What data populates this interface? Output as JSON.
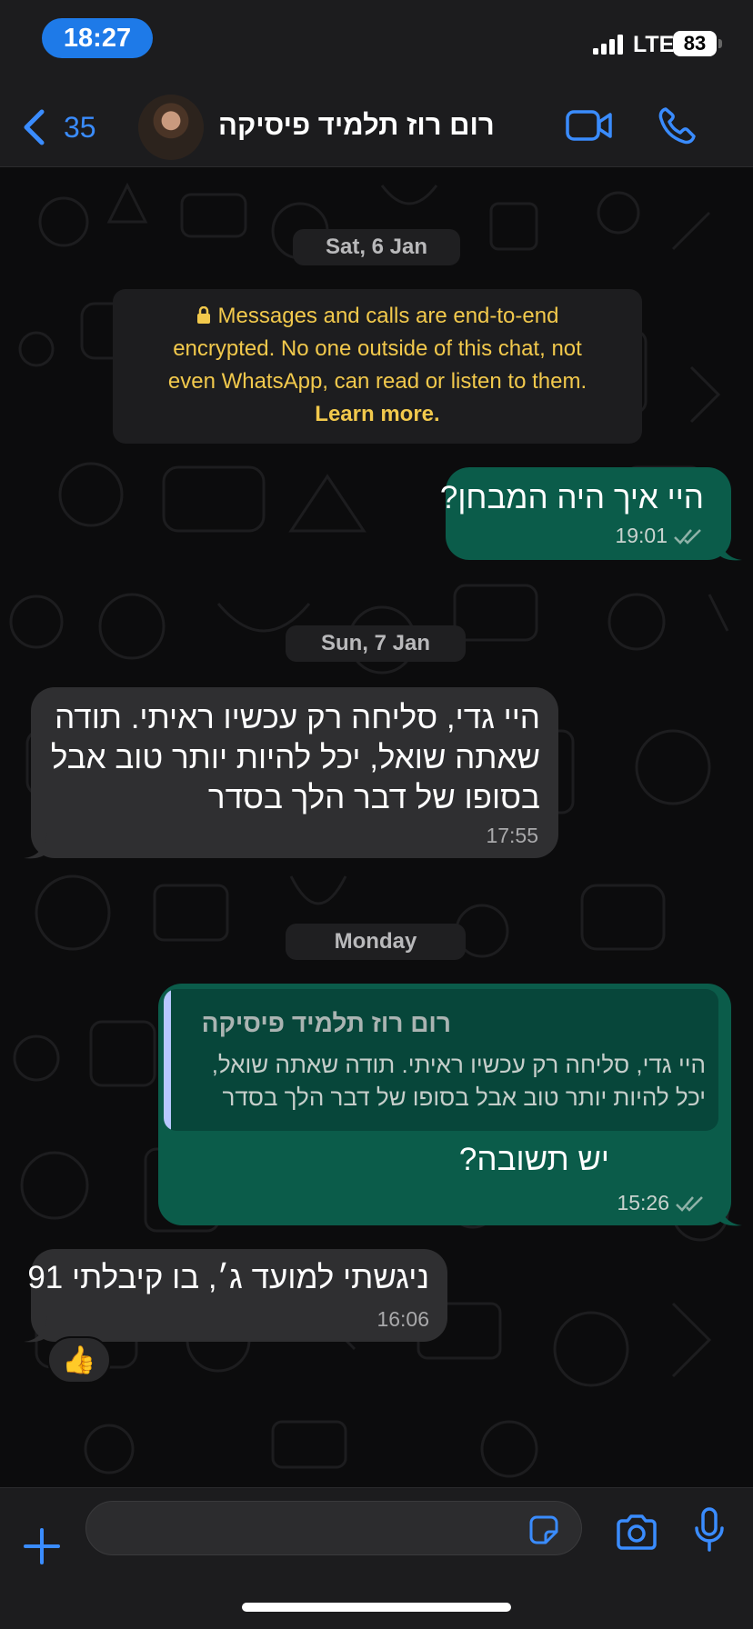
{
  "status_bar": {
    "time": "18:27",
    "network": "LTE",
    "battery": "83"
  },
  "header": {
    "back_count": "35",
    "contact_name": "רום רוז תלמיד פיסיקה"
  },
  "chat": {
    "date_1": "Sat, 6 Jan",
    "encryption": {
      "line1": "Messages and calls are end-to-end",
      "line2": "encrypted. No one outside of this chat, not",
      "line3": "even WhatsApp, can read or listen to them.",
      "learn_more": "Learn more."
    },
    "msg_1": {
      "text": "היי איך היה המבחן?",
      "time": "19:01"
    },
    "date_2": "Sun, 7 Jan",
    "msg_2": {
      "line1": "היי גדי, סליחה רק עכשיו ראיתי. תודה",
      "line2": "שאתה שואל, יכל להיות יותר טוב אבל",
      "line3": "בסופו של דבר הלך בסדר",
      "time": "17:55"
    },
    "date_3": "Monday",
    "msg_3": {
      "quote_name": "רום רוז תלמיד פיסיקה",
      "quote_line1": "היי גדי, סליחה רק עכשיו ראיתי. תודה שאתה שואל,",
      "quote_line2": "יכל להיות יותר טוב אבל בסופו של דבר הלך בסדר",
      "text": "יש תשובה?",
      "time": "15:26"
    },
    "msg_4": {
      "text": "ניגשתי למועד ג׳, בו קיבלתי 91",
      "time": "16:06",
      "reaction": "👍"
    }
  },
  "composer": {
    "value": "",
    "placeholder": ""
  },
  "colors": {
    "accent": "#3a8cff",
    "outgoing_bubble": "#0b5c4a",
    "incoming_bubble": "#2f2f31",
    "notice_text": "#f2c94c"
  },
  "icons": [
    "back-chevron-icon",
    "video-call-icon",
    "phone-icon",
    "lock-icon",
    "double-check-icon",
    "plus-icon",
    "sticker-icon",
    "camera-icon",
    "microphone-icon"
  ]
}
